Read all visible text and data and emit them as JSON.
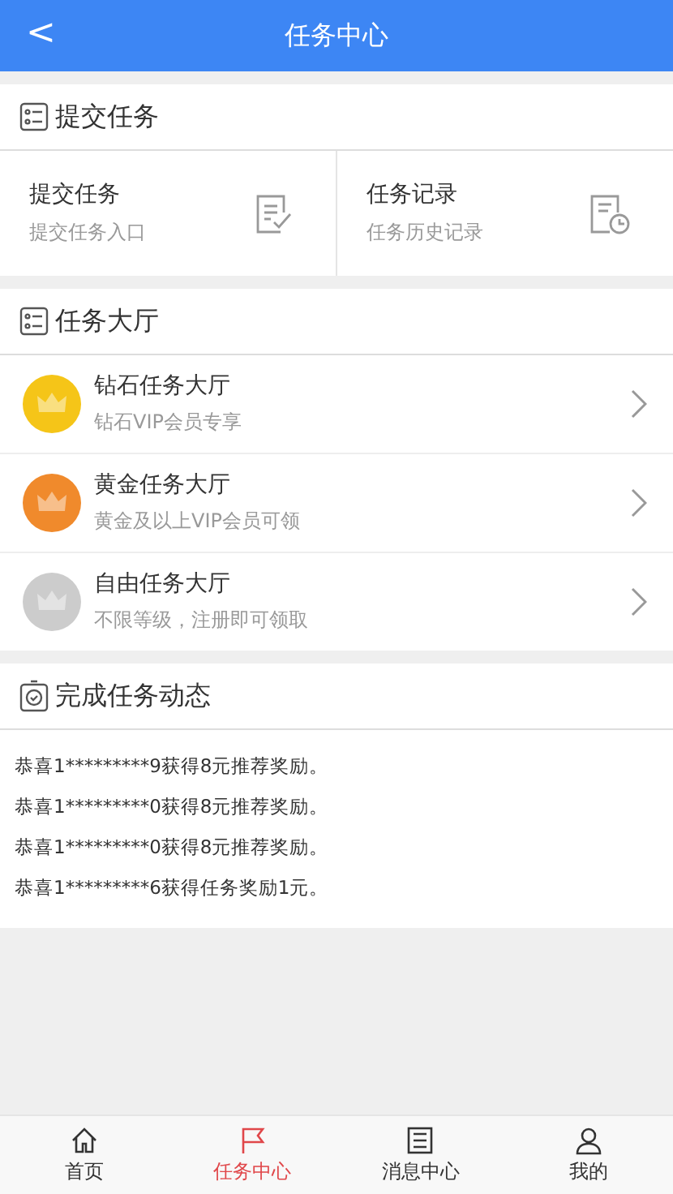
{
  "header": {
    "back": "<",
    "title": "任务中心"
  },
  "submit_section": {
    "title": "提交任务",
    "cards": [
      {
        "kind": "submit",
        "title": "提交任务",
        "subtitle": "提交任务入口"
      },
      {
        "kind": "history",
        "title": "任务记录",
        "subtitle": "任务历史记录"
      }
    ]
  },
  "hall_section": {
    "title": "任务大厅",
    "items": [
      {
        "title": "钻石任务大厅",
        "subtitle": "钻石VIP会员专享",
        "color": "#f5c518"
      },
      {
        "title": "黄金任务大厅",
        "subtitle": "黄金及以上VIP会员可领",
        "color": "#f08a2c"
      },
      {
        "title": "自由任务大厅",
        "subtitle": "不限等级，注册即可领取",
        "color": "#cccccc"
      }
    ]
  },
  "feed_section": {
    "title": "完成任务动态",
    "messages": [
      "恭喜1*********9获得8元推荐奖励。",
      "恭喜1*********0获得8元推荐奖励。",
      "恭喜1*********0获得8元推荐奖励。",
      "恭喜1*********6获得任务奖励1元。"
    ]
  },
  "tab_bar": [
    {
      "kind": "home",
      "label": "首页",
      "selected": false
    },
    {
      "kind": "flag",
      "label": "任务中心",
      "selected": true
    },
    {
      "kind": "list",
      "label": "消息中心",
      "selected": false
    },
    {
      "kind": "user",
      "label": "我的",
      "selected": false
    }
  ]
}
